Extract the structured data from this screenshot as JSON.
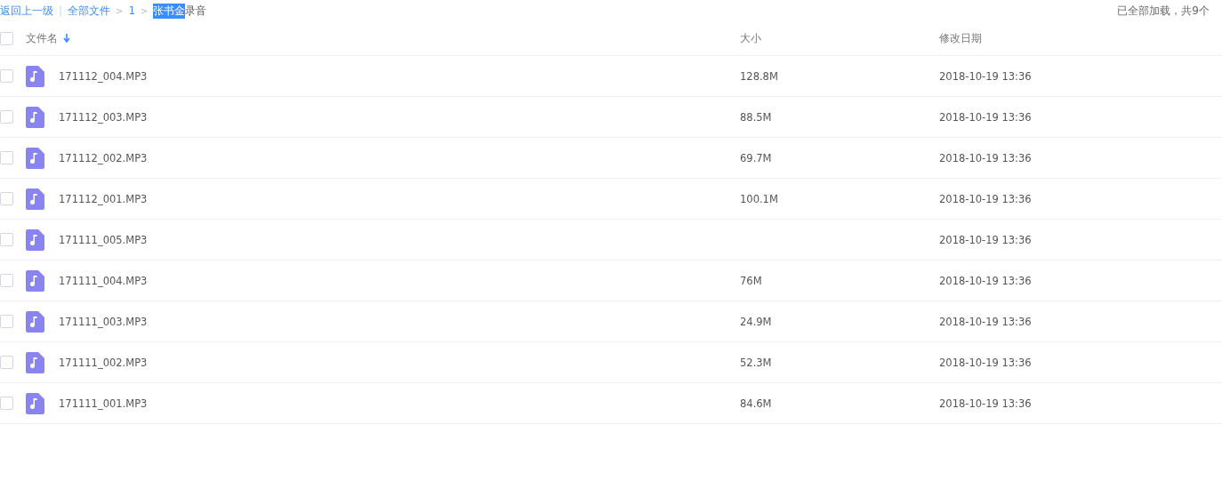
{
  "breadcrumb": {
    "back": "返回上一级",
    "divider": "|",
    "separator": ">",
    "items": [
      "全部文件",
      "1"
    ],
    "current": [
      {
        "text": "张书金",
        "highlighted": true
      },
      {
        "text": "录音",
        "highlighted": false
      }
    ]
  },
  "load_status": "已全部加载，共9个",
  "table": {
    "columns": [
      "文件名",
      "大小",
      "修改日期"
    ],
    "select_all": {
      "checked": false
    },
    "rows": [
      {
        "name": "171112_004.MP3",
        "size": "128.8M",
        "date": "2018-10-19 13:36",
        "checked": false
      },
      {
        "name": "171112_003.MP3",
        "size": "88.5M",
        "date": "2018-10-19 13:36",
        "checked": false
      },
      {
        "name": "171112_002.MP3",
        "size": "69.7M",
        "date": "2018-10-19 13:36",
        "checked": false
      },
      {
        "name": "171112_001.MP3",
        "size": "100.1M",
        "date": "2018-10-19 13:36",
        "checked": false
      },
      {
        "name": "171111_005.MP3",
        "date": "2018-10-19 13:36",
        "checked": false
      },
      {
        "name": "171111_004.MP3",
        "size": "76M",
        "date": "2018-10-19 13:36",
        "checked": false
      },
      {
        "name": "171111_003.MP3",
        "size": "24.9M",
        "date": "2018-10-19 13:36",
        "checked": false
      },
      {
        "name": "171111_002.MP3",
        "size": "52.3M",
        "date": "2018-10-19 13:36",
        "checked": false
      },
      {
        "name": "171111_001.MP3",
        "size": "84.6M",
        "date": "2018-10-19 13:36",
        "checked": false
      }
    ]
  }
}
